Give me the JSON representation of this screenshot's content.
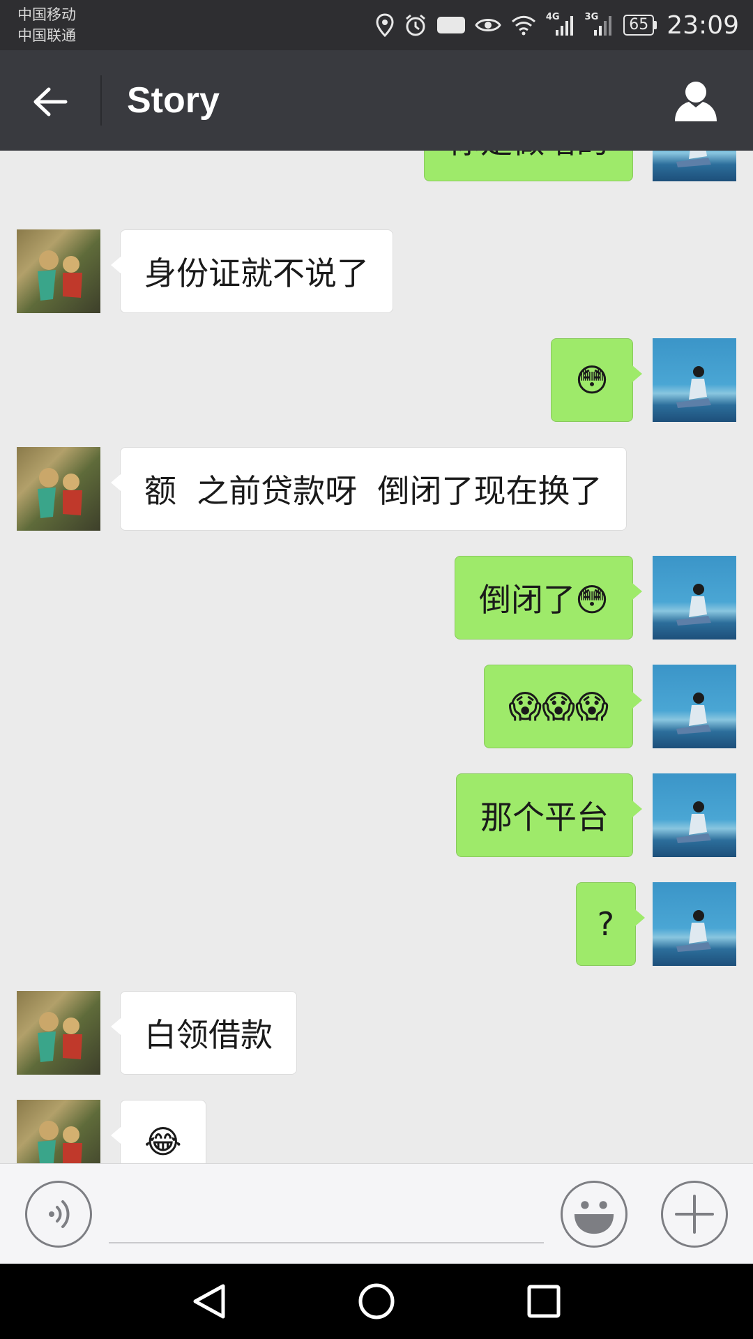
{
  "status_bar": {
    "carrier_1": "中国移动",
    "carrier_2": "中国联通",
    "network_1": "4G",
    "network_2": "3G",
    "battery": "65",
    "time": "23:09",
    "hd_label": "HD",
    "icons": [
      "location-icon",
      "alarm-icon",
      "hd-icon",
      "eye-icon",
      "wifi-icon",
      "signal-icon",
      "signal-icon",
      "battery-icon"
    ]
  },
  "header": {
    "title": "Story",
    "back_icon": "arrow-left-icon",
    "profile_icon": "person-icon"
  },
  "messages": [
    {
      "sender": "self",
      "text": "你是做啥的"
    },
    {
      "sender": "other",
      "text": "身份证就不说了"
    },
    {
      "sender": "self",
      "text": "😳"
    },
    {
      "sender": "other",
      "text": "额  之前贷款呀  倒闭了现在换了"
    },
    {
      "sender": "self",
      "text": "倒闭了😳"
    },
    {
      "sender": "self",
      "text": "😱😱😱"
    },
    {
      "sender": "self",
      "text": "那个平台"
    },
    {
      "sender": "self",
      "text": "?"
    },
    {
      "sender": "other",
      "text": "白领借款"
    },
    {
      "sender": "other",
      "text": "😂"
    }
  ],
  "input_bar": {
    "voice_icon": "voice-icon",
    "emoji_icon": "smiley-icon",
    "more_icon": "plus-icon",
    "input_value": ""
  },
  "nav_bar": {
    "icons": [
      "back-triangle-icon",
      "home-circle-icon",
      "recents-square-icon"
    ]
  },
  "colors": {
    "title_bar": "#393a3f",
    "status_bar": "#2e2e31",
    "chat_background": "#ebebeb",
    "self_bubble": "#9eea6a",
    "other_bubble": "#ffffff"
  }
}
